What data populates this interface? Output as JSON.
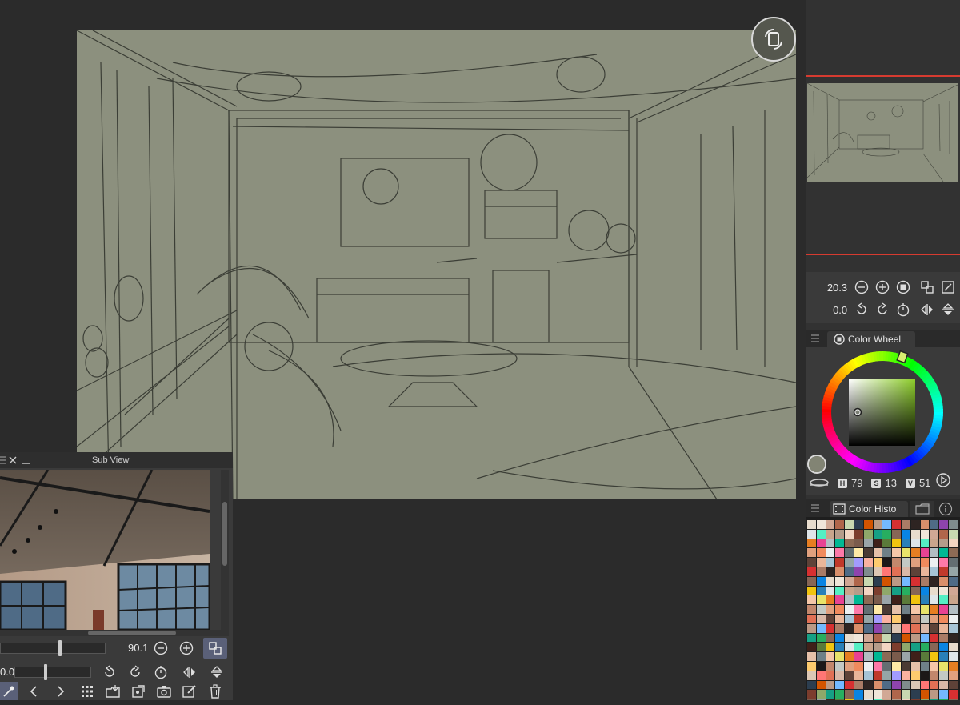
{
  "canvas": {
    "background": "#8c907e"
  },
  "navigator": {
    "zoom_value": "20.3",
    "rotation_value": "0.0"
  },
  "color_wheel": {
    "tab_label": "Color Wheel",
    "h_label": "H",
    "h_value": "79",
    "s_label": "S",
    "s_value": "13",
    "v_label": "V",
    "v_value": "51",
    "current_color": "#828474"
  },
  "color_history": {
    "tab_label": "Color Histo"
  },
  "sub_view": {
    "title": "Sub View",
    "zoom_value": "90.1",
    "rotation_value": "0.0"
  },
  "icons": [
    "rotate-canvas-icon",
    "zoom-out-icon",
    "zoom-in-icon",
    "fit-icon",
    "actual-size-icon",
    "fit-window-icon",
    "rotate-left-icon",
    "rotate-right-icon",
    "reset-rotation-icon",
    "flip-horizontal-icon",
    "flip-vertical-icon",
    "menu-icon",
    "close-icon",
    "minimize-icon",
    "eyedropper-icon",
    "prev-icon",
    "next-icon",
    "grid-icon",
    "import-icon",
    "reference-icon",
    "camera-icon",
    "edit-icon",
    "trash-icon",
    "play-icon",
    "info-icon",
    "film-icon"
  ]
}
